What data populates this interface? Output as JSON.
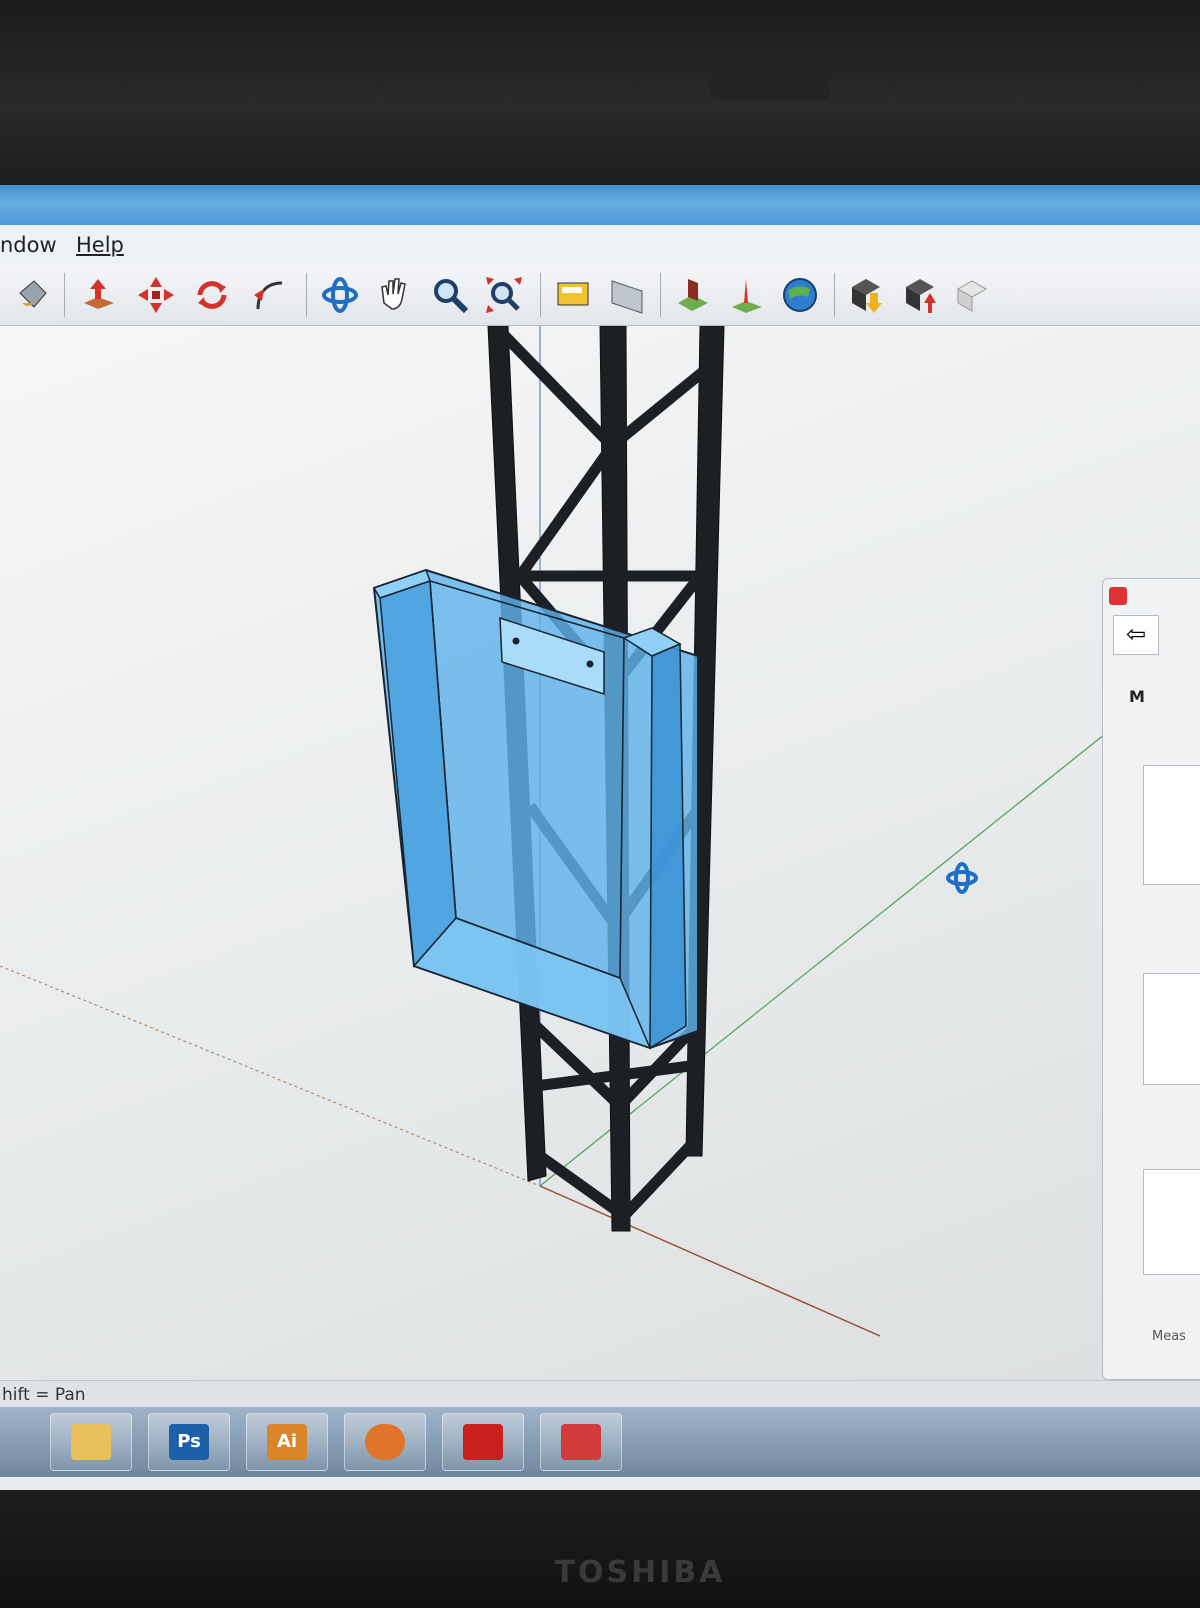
{
  "window": {
    "menu": [
      "ndow",
      "Help"
    ]
  },
  "toolbar": {
    "tools": [
      {
        "name": "paint-bucket-icon"
      },
      {
        "name": "push-pull-icon"
      },
      {
        "name": "move-icon"
      },
      {
        "name": "rotate-icon"
      },
      {
        "name": "follow-me-icon"
      },
      {
        "name": "orbit-icon"
      },
      {
        "name": "pan-icon"
      },
      {
        "name": "zoom-icon"
      },
      {
        "name": "zoom-extents-icon"
      },
      {
        "name": "section-plane-icon"
      },
      {
        "name": "section-display-icon"
      },
      {
        "name": "add-location-icon"
      },
      {
        "name": "toggle-terrain-icon"
      },
      {
        "name": "google-earth-icon"
      },
      {
        "name": "get-models-icon"
      },
      {
        "name": "share-model-icon"
      },
      {
        "name": "share-component-icon"
      }
    ]
  },
  "status": {
    "hint": "hift = Pan",
    "measurements_label": "Meas"
  },
  "tray": {
    "tab_label": "M"
  },
  "taskbar": {
    "items": [
      {
        "name": "folder-icon",
        "label": ""
      },
      {
        "name": "photoshop-icon",
        "label": "Ps"
      },
      {
        "name": "illustrator-icon",
        "label": "Ai"
      },
      {
        "name": "media-player-icon",
        "label": ""
      },
      {
        "name": "acrobat-icon",
        "label": ""
      },
      {
        "name": "sketchup-icon",
        "label": ""
      }
    ]
  },
  "device": {
    "brand": "TOSHIBA"
  },
  "colors": {
    "accent": "#3f8fcf",
    "model_blue": "#5fb2ea",
    "truss": "#1c1f24"
  }
}
